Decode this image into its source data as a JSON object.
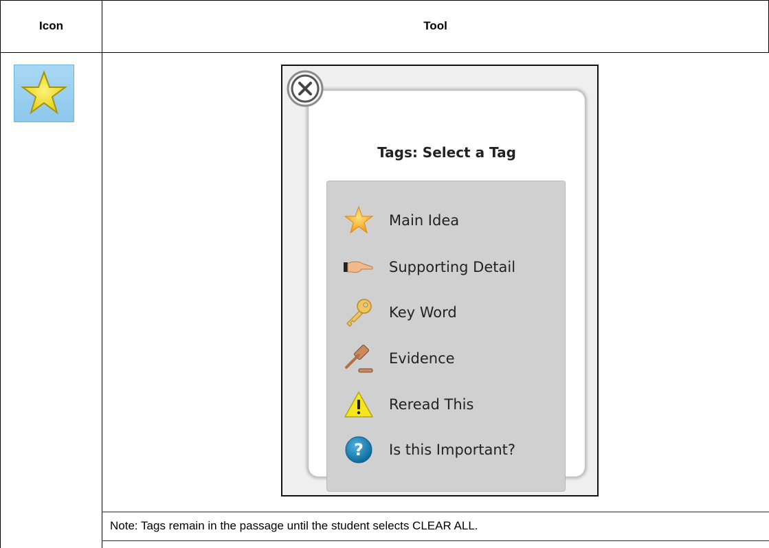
{
  "table": {
    "header_icon": "Icon",
    "header_tool": "Tool"
  },
  "row_icon": "star-icon",
  "tag_popup": {
    "close_icon": "close-x-circle-icon",
    "title": "Tags: Select a Tag",
    "tags": [
      {
        "icon": "star-icon",
        "label": "Main Idea"
      },
      {
        "icon": "pointing-hand-icon",
        "label": "Supporting Detail"
      },
      {
        "icon": "key-icon",
        "label": "Key Word"
      },
      {
        "icon": "gavel-icon",
        "label": "Evidence"
      },
      {
        "icon": "warning-triangle-icon",
        "label": "Reread This"
      },
      {
        "icon": "question-circle-icon",
        "label": "Is this Important?"
      }
    ]
  },
  "note": "Note: Tags remain in the passage until the student selects CLEAR ALL.",
  "colors": {
    "note_rule": "#1f2a6b",
    "tag_list_bg": "#d0d0d0",
    "icon_tile_bg": "#a9d8f3"
  }
}
